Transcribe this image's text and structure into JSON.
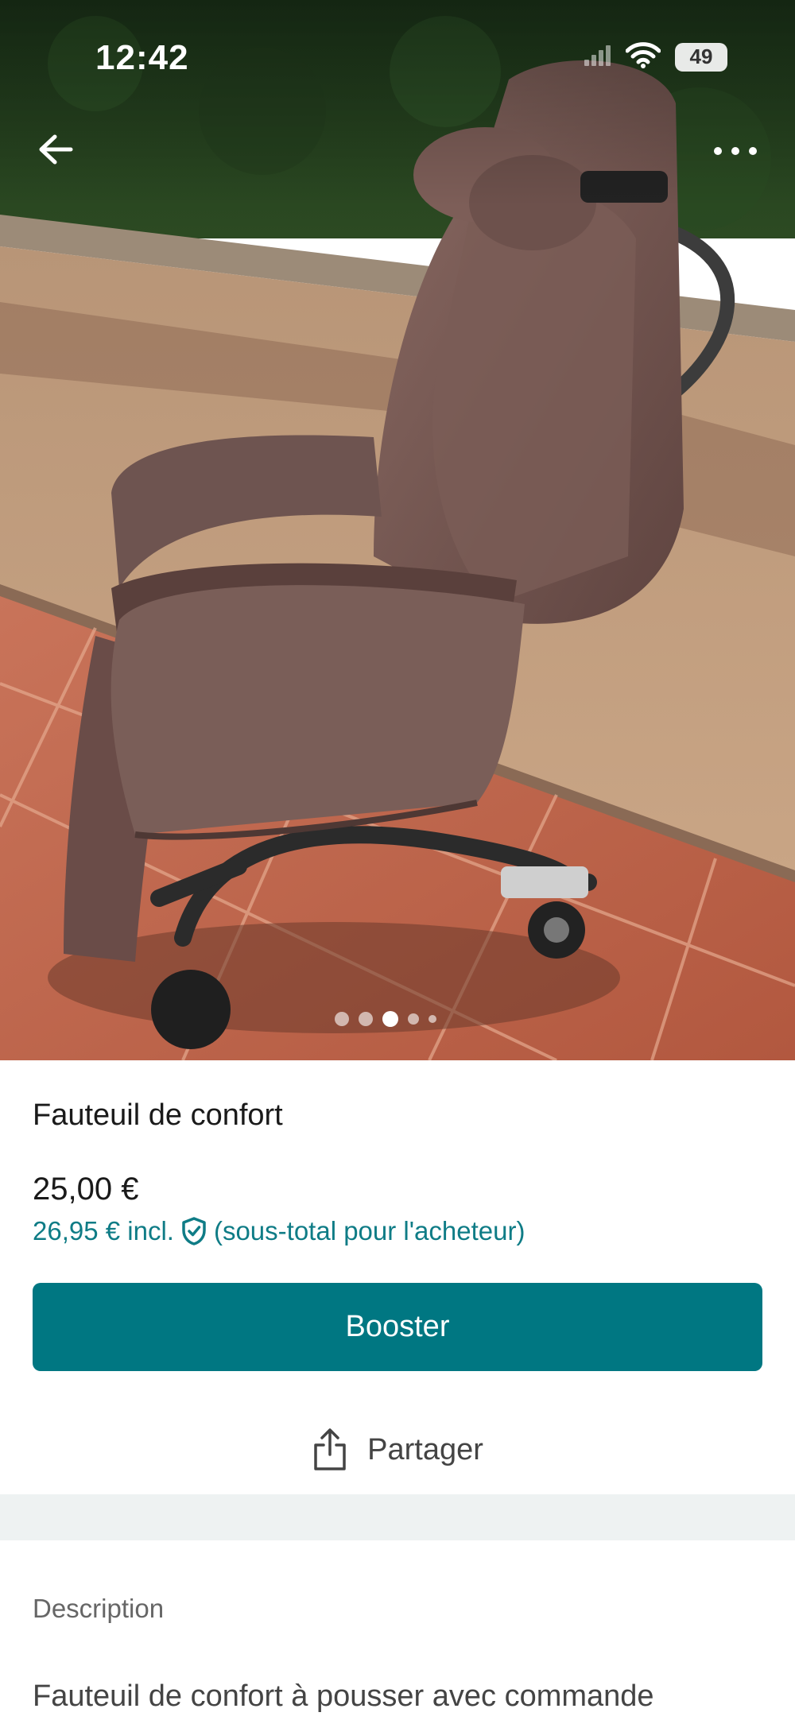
{
  "status_bar": {
    "time": "12:42",
    "battery": "49"
  },
  "photo": {
    "dot_count": 5,
    "active_dot": 2
  },
  "item": {
    "title": "Fauteuil de confort",
    "price": "25,00 €",
    "buyer_price": "26,95 € incl.",
    "buyer_price_note": "(sous-total pour l'acheteur)"
  },
  "actions": {
    "boost_label": "Booster",
    "share_label": "Partager"
  },
  "description": {
    "label": "Description",
    "text": "Fauteuil de confort à pousser avec commande"
  },
  "colors": {
    "accent": "#007782",
    "accent_text": "#0f7c86",
    "separator": "#eef2f2"
  },
  "icons": [
    "back-arrow-icon",
    "more-icon",
    "wifi-icon",
    "signal-icon",
    "shield-check-icon",
    "share-icon"
  ]
}
